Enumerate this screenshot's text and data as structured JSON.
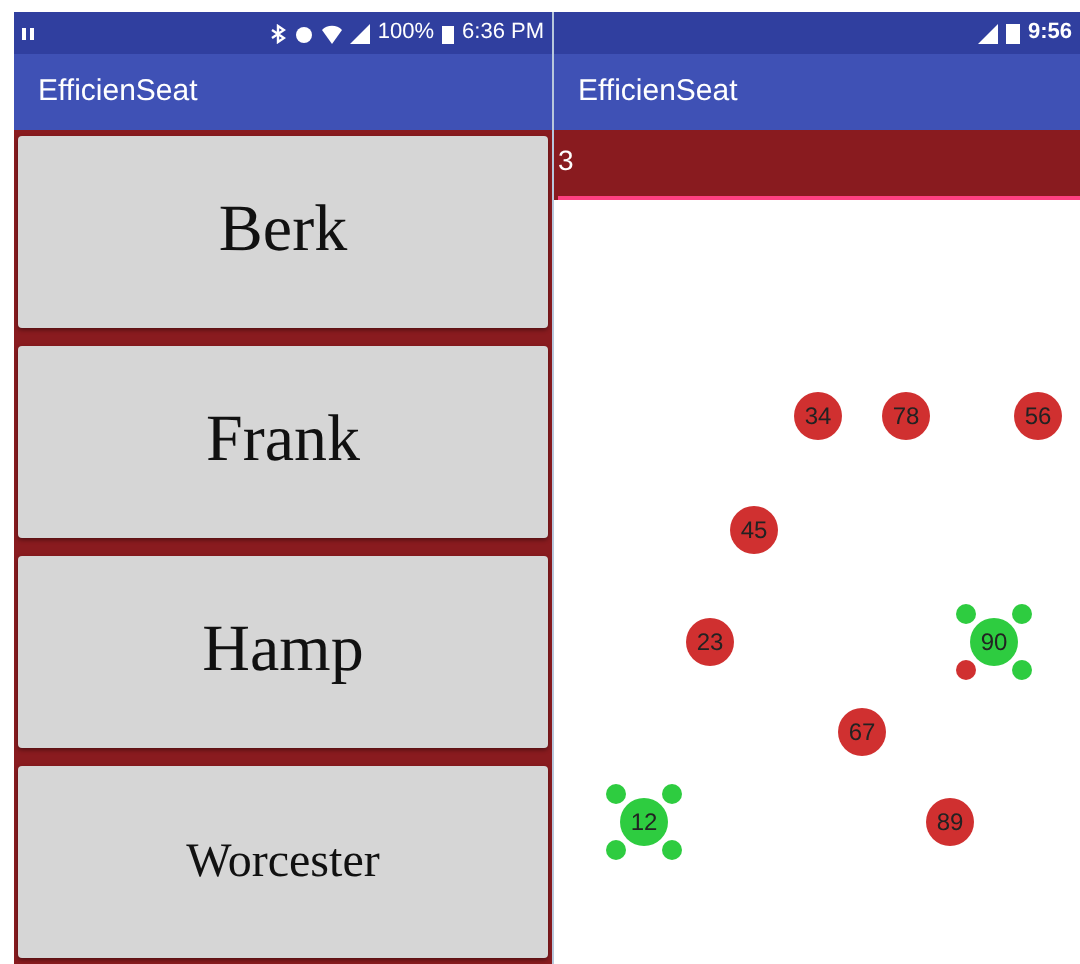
{
  "left_screen": {
    "status_bar": {
      "battery": "100%",
      "time": "6:36 PM"
    },
    "app_title": "EfficienSeat",
    "buttons": [
      {
        "label": "Berk",
        "kind": "large"
      },
      {
        "label": "Frank",
        "kind": "large"
      },
      {
        "label": "Hamp",
        "kind": "large"
      },
      {
        "label": "Worcester",
        "kind": "medium"
      }
    ]
  },
  "right_screen": {
    "status_bar": {
      "time": "9:56"
    },
    "app_title": "EfficienSeat",
    "input": {
      "value": "3"
    },
    "tables": [
      {
        "label": "34",
        "color": "#d03030"
      },
      {
        "label": "78",
        "color": "#d03030"
      },
      {
        "label": "56",
        "color": "#d03030"
      },
      {
        "label": "45",
        "color": "#d03030"
      },
      {
        "label": "23",
        "color": "#d03030"
      },
      {
        "label": "90",
        "color": "#2ecc40",
        "seats": [
          {
            "color": "#2ecc40"
          },
          {
            "color": "#2ecc40"
          },
          {
            "color": "#d03030"
          },
          {
            "color": "#2ecc40"
          }
        ]
      },
      {
        "label": "67",
        "color": "#d03030"
      },
      {
        "label": "12",
        "color": "#2ecc40",
        "seats": [
          {
            "color": "#2ecc40"
          },
          {
            "color": "#2ecc40"
          },
          {
            "color": "#2ecc40"
          },
          {
            "color": "#2ecc40"
          }
        ]
      },
      {
        "label": "89",
        "color": "#d03030"
      }
    ]
  }
}
